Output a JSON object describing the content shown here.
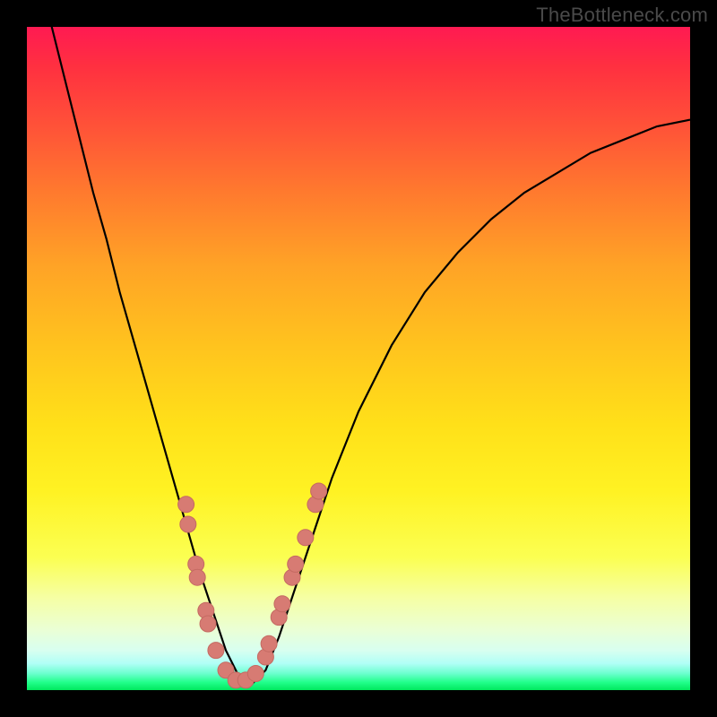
{
  "watermark": "TheBottleneck.com",
  "colors": {
    "frame": "#000000",
    "curve": "#000000",
    "marker_fill": "#d77b73",
    "marker_stroke": "#c46a62"
  },
  "chart_data": {
    "type": "line",
    "title": "",
    "xlabel": "",
    "ylabel": "",
    "xlim": [
      0,
      100
    ],
    "ylim": [
      0,
      100
    ],
    "x": [
      0,
      2,
      4,
      6,
      8,
      10,
      12,
      14,
      16,
      18,
      20,
      22,
      24,
      26,
      27,
      28,
      29,
      30,
      31,
      32,
      33,
      34,
      36,
      38,
      40,
      42,
      44,
      46,
      50,
      55,
      60,
      65,
      70,
      75,
      80,
      85,
      90,
      95,
      100
    ],
    "y": [
      115,
      107,
      99,
      91,
      83,
      75,
      68,
      60,
      53,
      46,
      39,
      32,
      25,
      18,
      15,
      12,
      9,
      6,
      4,
      2,
      1,
      1,
      3,
      8,
      14,
      20,
      26,
      32,
      42,
      52,
      60,
      66,
      71,
      75,
      78,
      81,
      83,
      85,
      86
    ],
    "markers": [
      {
        "x": 24.0,
        "y": 28
      },
      {
        "x": 24.3,
        "y": 25
      },
      {
        "x": 25.5,
        "y": 19
      },
      {
        "x": 25.7,
        "y": 17
      },
      {
        "x": 27.0,
        "y": 12
      },
      {
        "x": 27.3,
        "y": 10
      },
      {
        "x": 28.5,
        "y": 6
      },
      {
        "x": 30.0,
        "y": 3
      },
      {
        "x": 31.5,
        "y": 1.5
      },
      {
        "x": 33.0,
        "y": 1.5
      },
      {
        "x": 34.5,
        "y": 2.5
      },
      {
        "x": 36.0,
        "y": 5
      },
      {
        "x": 36.5,
        "y": 7
      },
      {
        "x": 38.0,
        "y": 11
      },
      {
        "x": 38.5,
        "y": 13
      },
      {
        "x": 40.0,
        "y": 17
      },
      {
        "x": 40.5,
        "y": 19
      },
      {
        "x": 42.0,
        "y": 23
      },
      {
        "x": 43.5,
        "y": 28
      },
      {
        "x": 44.0,
        "y": 30
      }
    ],
    "marker_radius_px": 9
  }
}
